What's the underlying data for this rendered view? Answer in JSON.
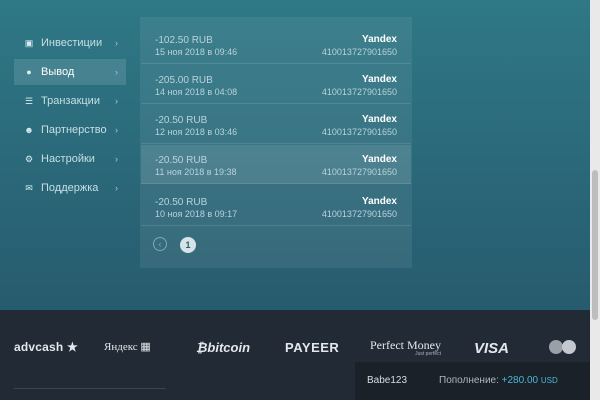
{
  "sidebar": {
    "items": [
      {
        "label": "Инвестиции",
        "icon": "briefcase-icon"
      },
      {
        "label": "Вывод",
        "icon": "globe-icon",
        "active": true
      },
      {
        "label": "Транзакции",
        "icon": "list-icon"
      },
      {
        "label": "Партнерство",
        "icon": "user-icon"
      },
      {
        "label": "Настройки",
        "icon": "gear-icon"
      },
      {
        "label": "Поддержка",
        "icon": "envelope-icon"
      }
    ]
  },
  "withdrawals": [
    {
      "amount": "-102.50 RUB",
      "date": "15 ноя 2018 в 09:46",
      "method": "Yandex",
      "wallet": "410013727901650"
    },
    {
      "amount": "-205.00 RUB",
      "date": "14 ноя 2018 в 04:08",
      "method": "Yandex",
      "wallet": "410013727901650"
    },
    {
      "amount": "-20.50 RUB",
      "date": "12 ноя 2018 в 03:46",
      "method": "Yandex",
      "wallet": "410013727901650"
    },
    {
      "amount": "-20.50 RUB",
      "date": "11 ноя 2018 в 19:38",
      "method": "Yandex",
      "wallet": "410013727901650"
    },
    {
      "amount": "-20.50 RUB",
      "date": "10 ноя 2018 в 09:17",
      "method": "Yandex",
      "wallet": "410013727901650"
    }
  ],
  "pagination": {
    "current": "1"
  },
  "payment_logos": {
    "advcash": "advcash",
    "yandex": "Яндекс",
    "bitcoin": "bitcoin",
    "payeer": "PAYEER",
    "perfect_money": "Perfect Money",
    "perfect_money_sub": "Just perfect",
    "visa": "VISA"
  },
  "toast": {
    "user": "Babe123",
    "label": "Пополнение:",
    "value": "+280.00",
    "currency": "USD"
  },
  "colors": {
    "accent": "#4ab6d8",
    "panel_bg": "#2b6b7c",
    "footer_bg": "#212a35"
  }
}
